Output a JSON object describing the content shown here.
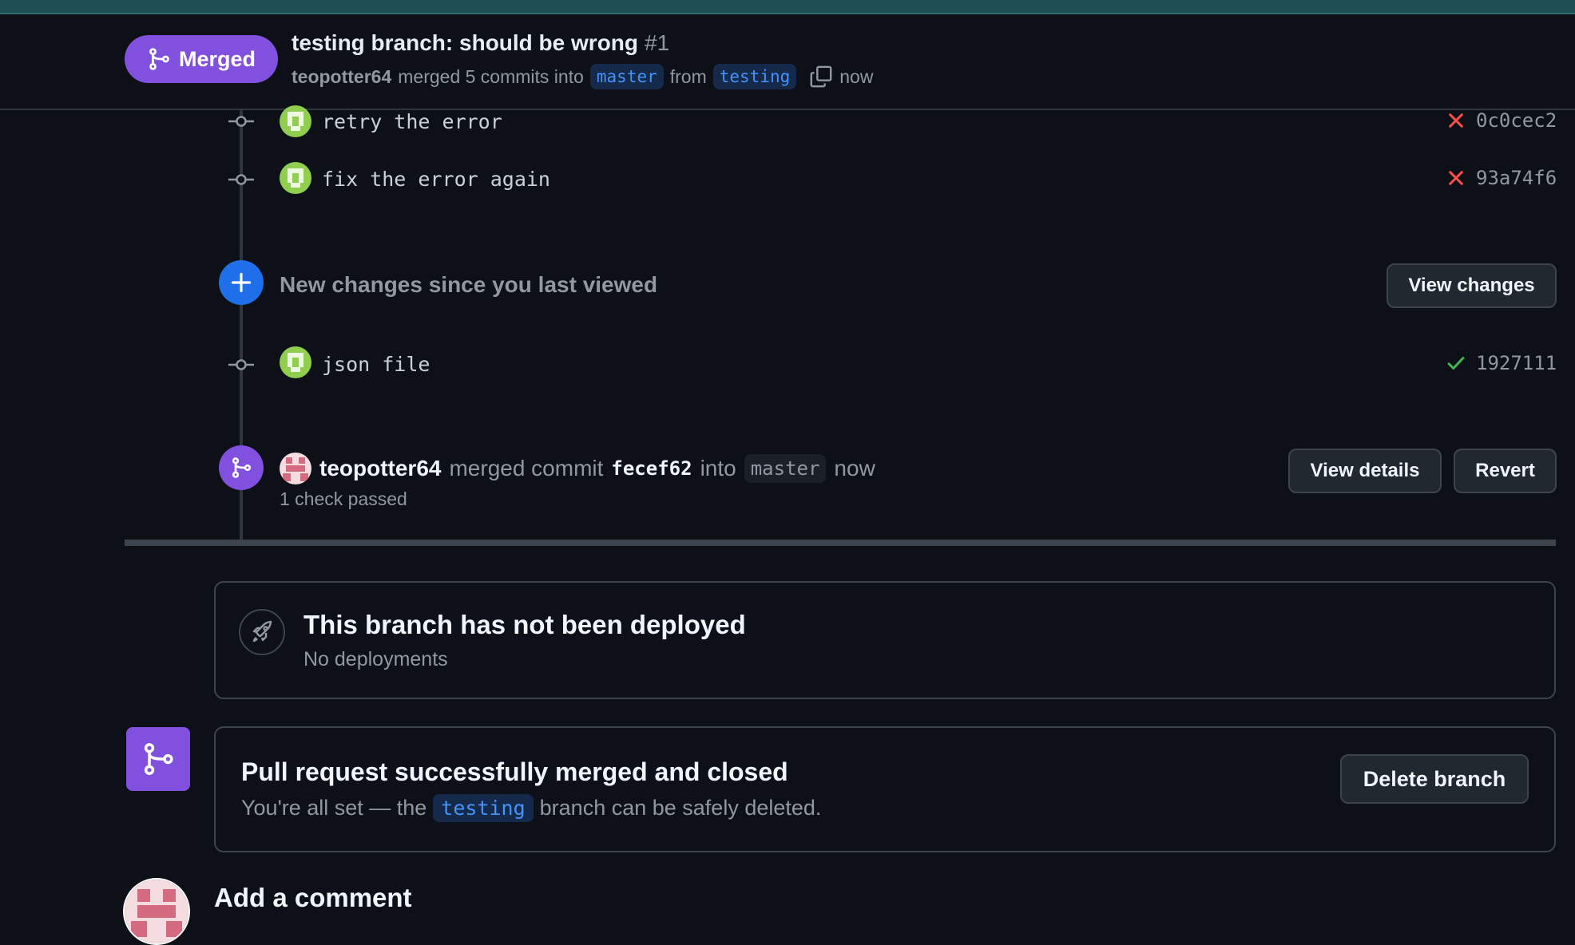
{
  "header": {
    "state_label": "Merged",
    "title": "testing branch: should be wrong",
    "number": "#1",
    "author": "teopotter64",
    "merged_text": "merged 5 commits into",
    "base_branch": "master",
    "from_text": "from",
    "head_branch": "testing",
    "time": "now"
  },
  "commits": [
    {
      "message": "retry the error",
      "sha": "0c0cec2",
      "status": "failure"
    },
    {
      "message": "fix the error again",
      "sha": "93a74f6",
      "status": "failure"
    },
    {
      "message": "json file",
      "sha": "1927111",
      "status": "success"
    }
  ],
  "new_changes": {
    "text": "New changes since you last viewed",
    "button": "View changes"
  },
  "merge_event": {
    "author": "teopotter64",
    "text1": "merged commit",
    "sha": "fecef62",
    "text2": "into",
    "branch": "master",
    "time": "now",
    "checks": "1 check passed",
    "details_button": "View details",
    "revert_button": "Revert"
  },
  "deployment": {
    "title": "This branch has not been deployed",
    "subtitle": "No deployments"
  },
  "merged_box": {
    "title": "Pull request successfully merged and closed",
    "sub_before": "You're all set — the",
    "branch": "testing",
    "sub_after": "branch can be safely deleted.",
    "button": "Delete branch"
  },
  "comment": {
    "title": "Add a comment"
  },
  "colors": {
    "merged_purple": "#8250df",
    "failure_red": "#f85149",
    "success_green": "#3fb950",
    "accent_blue": "#1f6feb"
  }
}
